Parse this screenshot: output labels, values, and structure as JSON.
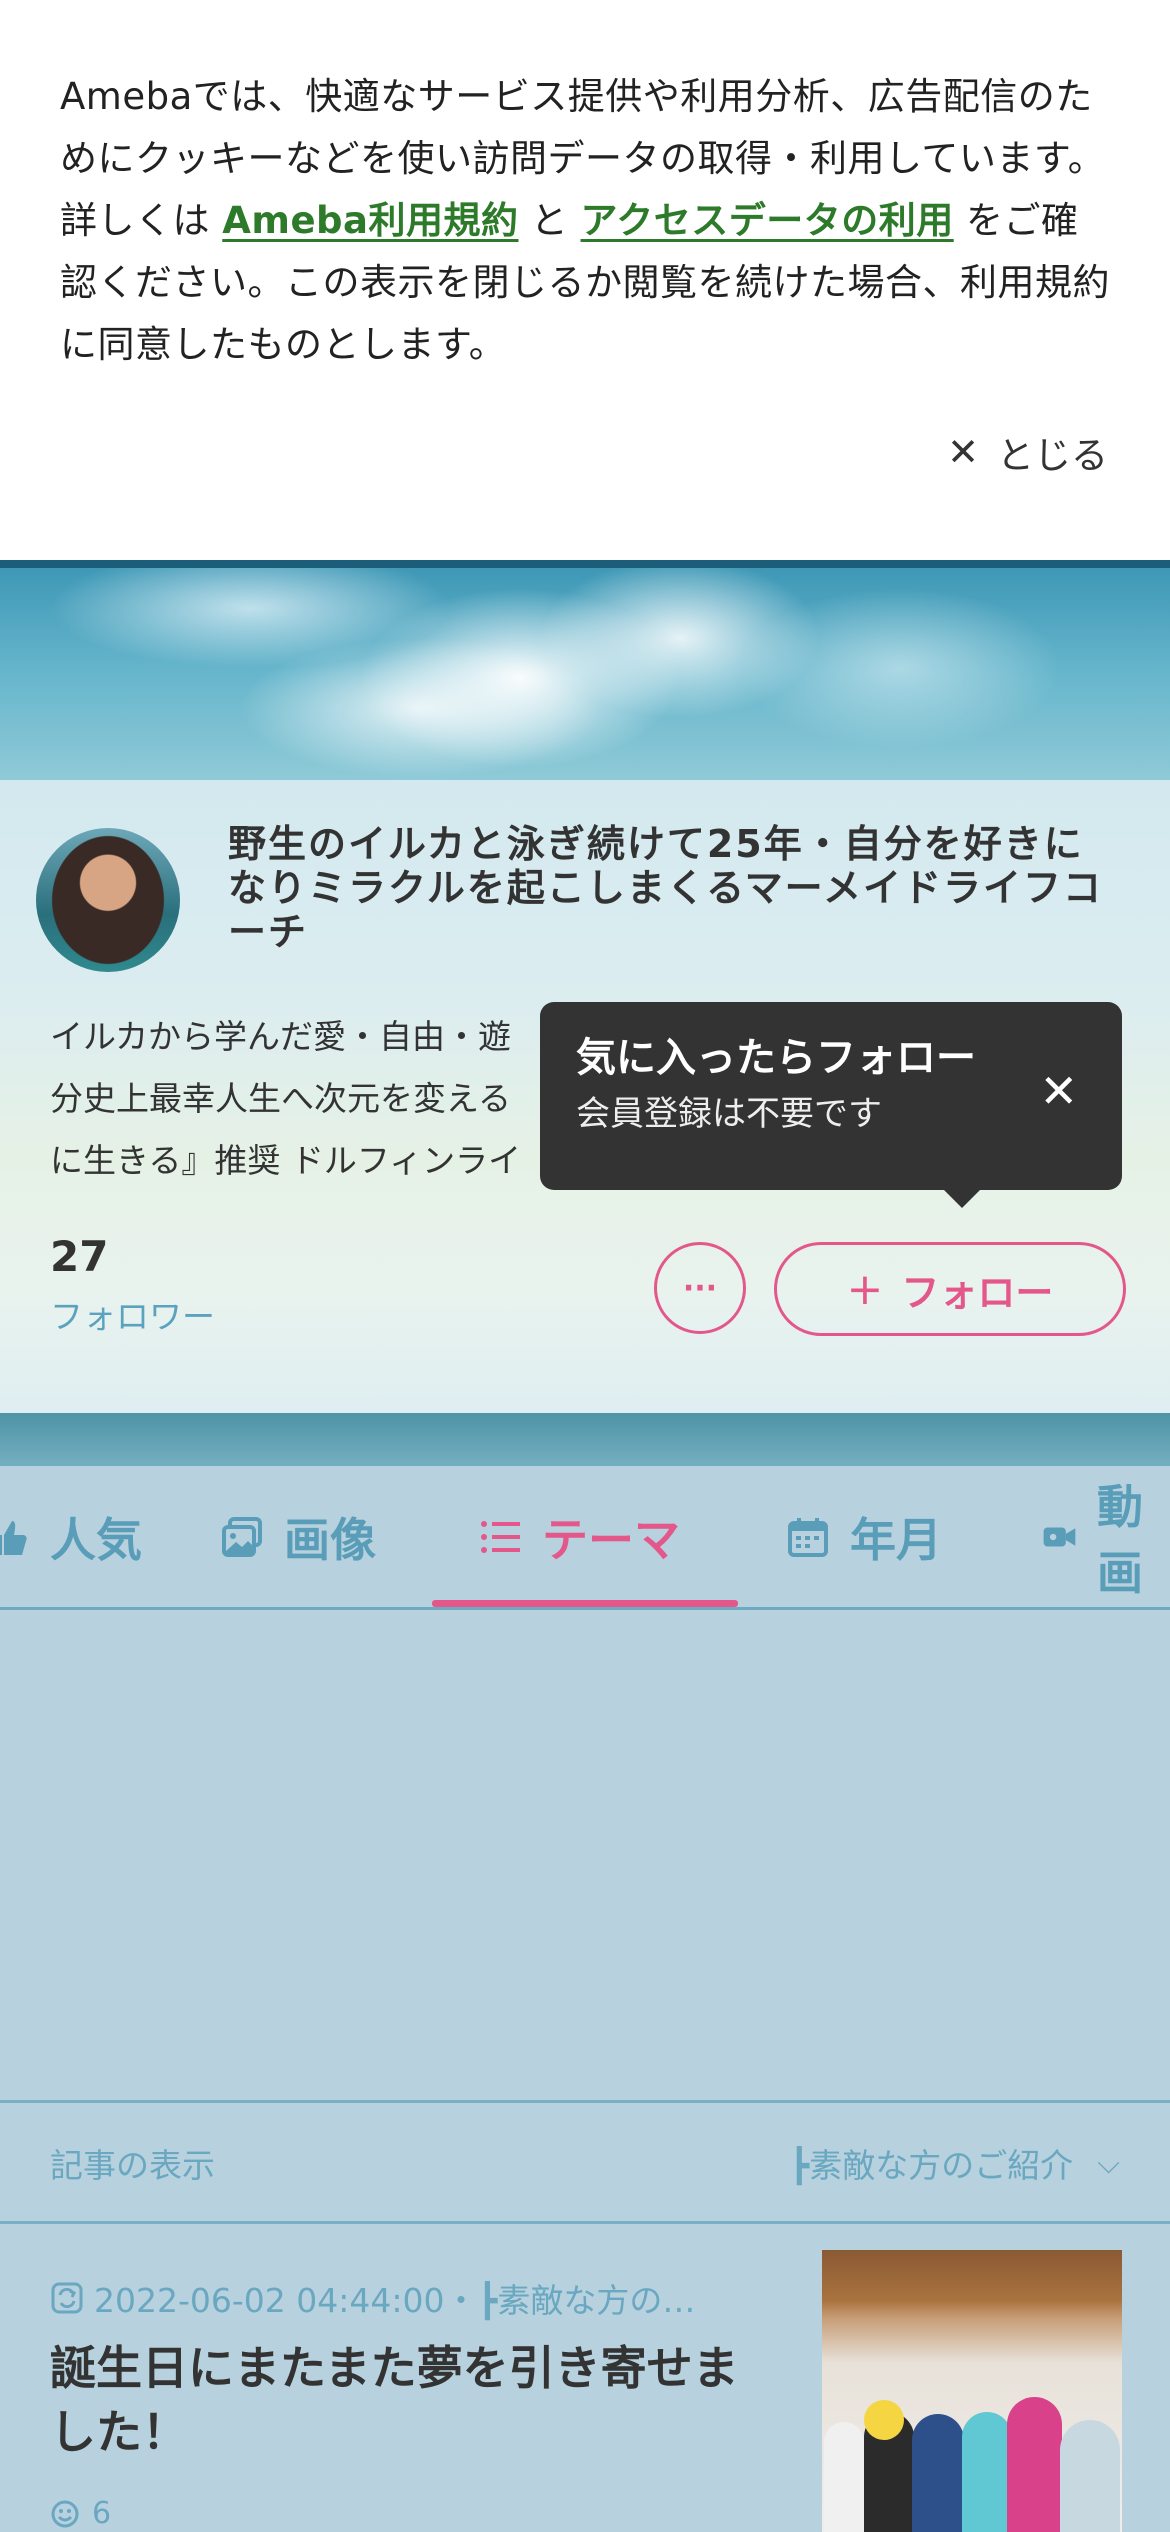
{
  "cookie": {
    "text_before": "Amebaでは、快適なサービス提供や利用分析、広告配信のためにクッキーなどを使い訪問データの取得・利用しています。詳しくは ",
    "link1": "Ameba利用規約",
    "text_mid": " と ",
    "link2": "アクセスデータの利用",
    "text_after": " をご確認ください。この表示を閉じるか閲覧を続けた場合、利用規約に同意したものとします。",
    "close_label": "とじる"
  },
  "profile": {
    "blog_title": "野生のイルカと泳ぎ続けて25年・自分を好きになりミラクルを起こしまくるマーメイドライフコーチ",
    "description": "イルカから学んだ愛・自由・遊\n分史上最幸人生へ次元を変える\nに生きる』推奨 ドルフィンライ",
    "followers_count": "27",
    "followers_label": "フォロワー",
    "more_label": "···",
    "follow_label": "フォロー"
  },
  "tooltip": {
    "title": "気に入ったらフォロー",
    "subtitle": "会員登録は不要です"
  },
  "tabs": [
    {
      "label": "人気",
      "icon": "popular-icon"
    },
    {
      "label": "画像",
      "icon": "image-icon"
    },
    {
      "label": "テーマ",
      "icon": "list-icon",
      "active": true
    },
    {
      "label": "年月",
      "icon": "calendar-icon"
    },
    {
      "label": "動画",
      "icon": "video-icon"
    }
  ],
  "filter": {
    "label": "記事の表示",
    "selected": "┣素敵な方のご紹介"
  },
  "article": {
    "meta": "2022-06-02 04:44:00・┣素敵な方の…",
    "title": "誕生日にまたまた夢を引き寄せました！",
    "likes": "6"
  },
  "colors": {
    "accent": "#e3578a",
    "link": "#2c7a2a",
    "muted_blue": "#5a9db8",
    "background": "#b7d2de"
  }
}
